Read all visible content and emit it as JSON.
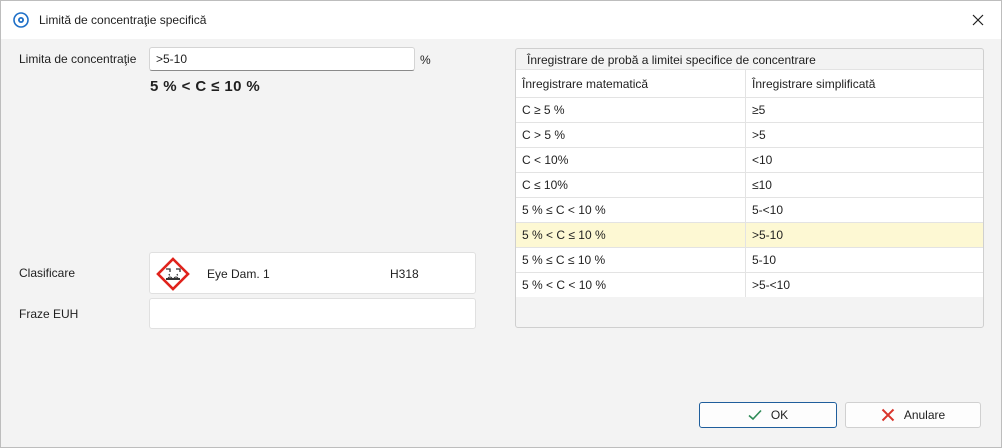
{
  "window": {
    "title": "Limită de concentraţie specifică"
  },
  "form": {
    "limit_label": "Limita de concentraţie",
    "limit_value": ">5-10",
    "unit": "%",
    "formula": "5 % < C ≤ 10 %",
    "classification_label": "Clasificare",
    "classification_name": "Eye Dam. 1",
    "classification_code": "H318",
    "euh_label": "Fraze EUH",
    "euh_value": ""
  },
  "samples": {
    "title": "Înregistrare de probă a limitei specifice de concentrare",
    "columns": [
      "Înregistrare matematică",
      "Înregistrare simplificată"
    ],
    "rows": [
      [
        "C ≥ 5 %",
        "≥5"
      ],
      [
        "C > 5 %",
        ">5"
      ],
      [
        "C < 10%",
        "<10"
      ],
      [
        "C ≤ 10%",
        "≤10"
      ],
      [
        "5 % ≤ C < 10 %",
        "5-<10"
      ],
      [
        "5 % < C ≤ 10 %",
        ">5-10"
      ],
      [
        "5 % ≤ C ≤ 10 %",
        "5-10"
      ],
      [
        "5 % < C < 10 %",
        ">5-<10"
      ]
    ],
    "selected_row": 5
  },
  "buttons": {
    "ok": "OK",
    "cancel": "Anulare"
  },
  "colors": {
    "accent": "#1f5e9c",
    "selected_row": "#fdf8d3",
    "hazard_red": "#e0221b",
    "ok_check": "#2e8b57",
    "cancel_x": "#d9342b"
  },
  "icons": {
    "app": "app-target-icon",
    "close": "close-icon",
    "hazard": "ghs05-corrosion-icon",
    "ok": "check-icon",
    "cancel": "x-icon"
  }
}
